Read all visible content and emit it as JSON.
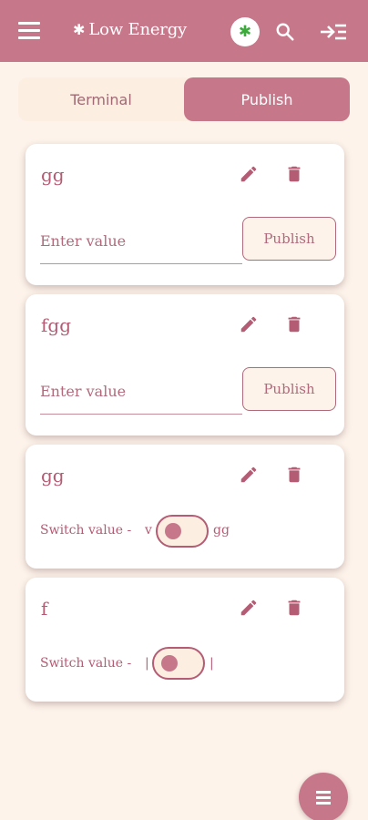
{
  "appbar": {
    "title": "Low Energy",
    "icons": [
      "menu-icon",
      "bluetooth-icon",
      "bluetooth-connected-icon",
      "search-icon",
      "login-icon"
    ],
    "colors": {
      "primary": "#c6788a",
      "bluetooth_status": "#3cab3c"
    }
  },
  "tabs": [
    {
      "label": "Terminal",
      "active": false
    },
    {
      "label": "Publish",
      "active": true
    }
  ],
  "cards": [
    {
      "name": "gg",
      "type": "text",
      "placeholder": "Enter value",
      "button": "Publish"
    },
    {
      "name": "fgg",
      "type": "text",
      "placeholder": "Enter value",
      "button": "Publish"
    },
    {
      "name": "gg",
      "type": "switch",
      "switch_label": "Switch value -",
      "off_value": "v",
      "on_value": "gg",
      "on": false
    },
    {
      "name": "f",
      "type": "switch",
      "switch_label": "Switch value -",
      "off_value": "|",
      "on_value": "|",
      "on": false
    }
  ],
  "fab": {
    "icon": "menu-icon"
  },
  "colors": {
    "background": "#fdf3ea",
    "card": "#ffffff",
    "text": "#b35c74"
  }
}
